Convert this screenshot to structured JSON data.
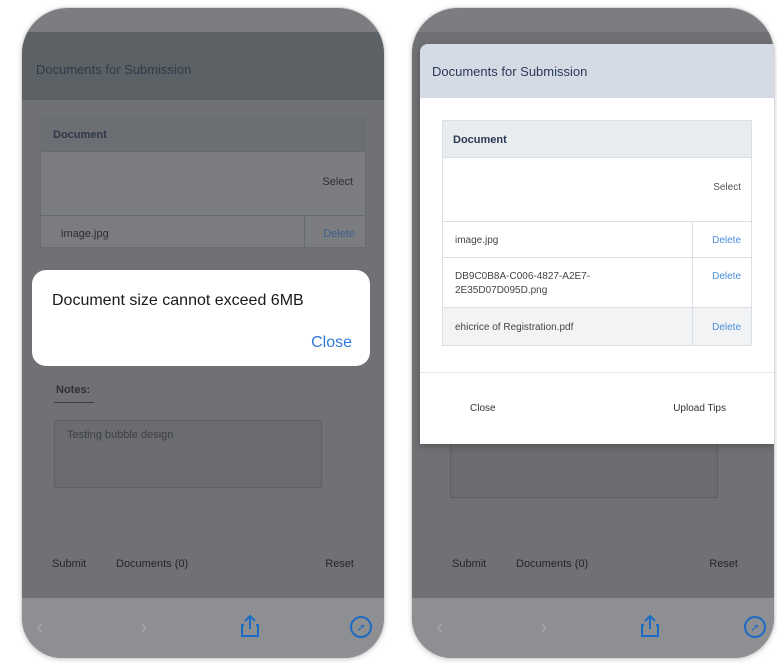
{
  "left": {
    "header_title": "Documents for Submission",
    "table_header": "Document",
    "select_label": "Select",
    "file_name": "image.jpg",
    "delete_label": "Delete",
    "notes_label": "Notes:",
    "notes_text": "Testing bubble design",
    "alert": {
      "message": "Document size cannot exceed 6MB",
      "close_label": "Close"
    },
    "bottom": {
      "submit": "Submit",
      "documents": "Documents (0)",
      "reset": "Reset"
    }
  },
  "right": {
    "modal": {
      "title": "Documents for Submission",
      "table_header": "Document",
      "select_label": "Select",
      "files": [
        {
          "name": "image.jpg",
          "delete_label": "Delete"
        },
        {
          "name": "DB9C0B8A-C006-4827-A2E7-2E35D07D095D.png",
          "delete_label": "Delete"
        },
        {
          "name": "ehicrice of Registration.pdf",
          "delete_label": "Delete"
        }
      ],
      "close_label": "Close",
      "upload_tips_label": "Upload Tips"
    },
    "bottom": {
      "submit": "Submit",
      "documents": "Documents (0)",
      "reset": "Reset"
    }
  },
  "safari": {
    "back_icon": "chevron-left-icon",
    "forward_icon": "chevron-right-icon",
    "share_icon": "share-icon",
    "compass_icon": "compass-icon"
  },
  "colors": {
    "link": "#2f7ad6",
    "overlay": "#7b7d80",
    "modal_header": "#d4dbe5"
  }
}
